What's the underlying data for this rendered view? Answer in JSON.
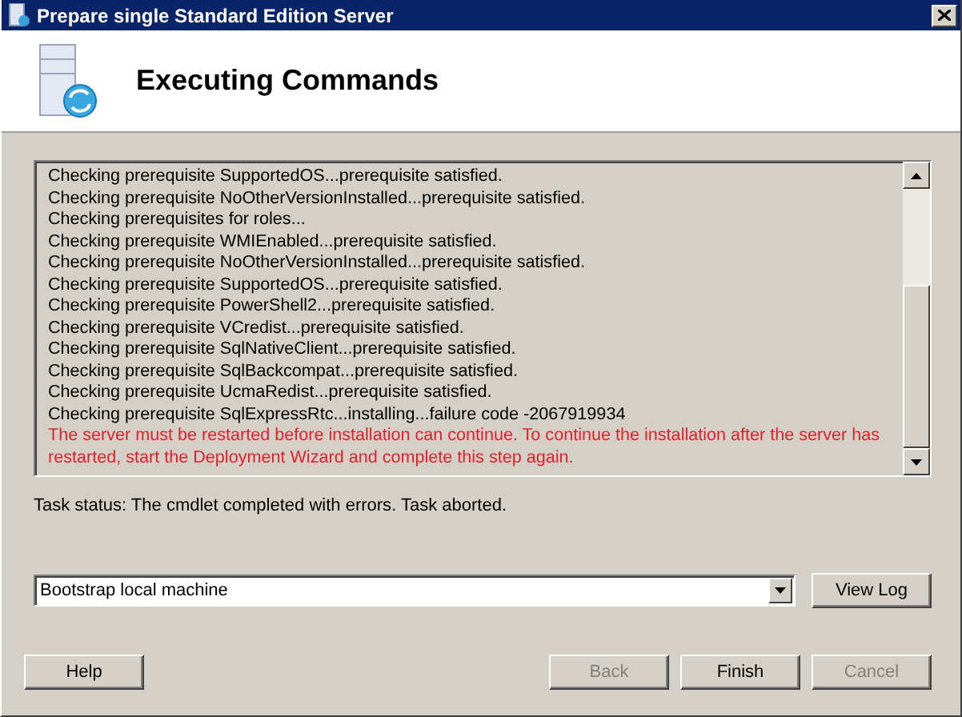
{
  "window": {
    "title": "Prepare single Standard Edition Server"
  },
  "header": {
    "title": "Executing Commands"
  },
  "log": [
    {
      "kind": "normal",
      "text": "Checking prerequisite SupportedOS...prerequisite satisfied."
    },
    {
      "kind": "normal",
      "text": "Checking prerequisite NoOtherVersionInstalled...prerequisite satisfied."
    },
    {
      "kind": "normal",
      "text": "Checking prerequisites for roles..."
    },
    {
      "kind": "normal",
      "text": "Checking prerequisite WMIEnabled...prerequisite satisfied."
    },
    {
      "kind": "normal",
      "text": "Checking prerequisite NoOtherVersionInstalled...prerequisite satisfied."
    },
    {
      "kind": "normal",
      "text": "Checking prerequisite SupportedOS...prerequisite satisfied."
    },
    {
      "kind": "normal",
      "text": "Checking prerequisite PowerShell2...prerequisite satisfied."
    },
    {
      "kind": "normal",
      "text": "Checking prerequisite VCredist...prerequisite satisfied."
    },
    {
      "kind": "normal",
      "text": "Checking prerequisite SqlNativeClient...prerequisite satisfied."
    },
    {
      "kind": "normal",
      "text": "Checking prerequisite SqlBackcompat...prerequisite satisfied."
    },
    {
      "kind": "normal",
      "text": "Checking prerequisite UcmaRedist...prerequisite satisfied."
    },
    {
      "kind": "normal",
      "text": "Checking prerequisite SqlExpressRtc...installing...failure code -2067919934"
    },
    {
      "kind": "error",
      "text": "The server must be restarted before installation can continue. To continue the installation after the server has restarted, start the Deployment Wizard and complete this step again."
    }
  ],
  "task_status": "Task status: The cmdlet completed with errors. Task aborted.",
  "task_select": {
    "value": "Bootstrap local machine"
  },
  "view_log_button": {
    "label": "View Log",
    "disabled": false
  },
  "buttons": [
    {
      "label": "Help",
      "disabled": false
    },
    {
      "label": "Back",
      "disabled": true
    },
    {
      "label": "Finish",
      "disabled": false
    },
    {
      "label": "Cancel",
      "disabled": true
    }
  ]
}
